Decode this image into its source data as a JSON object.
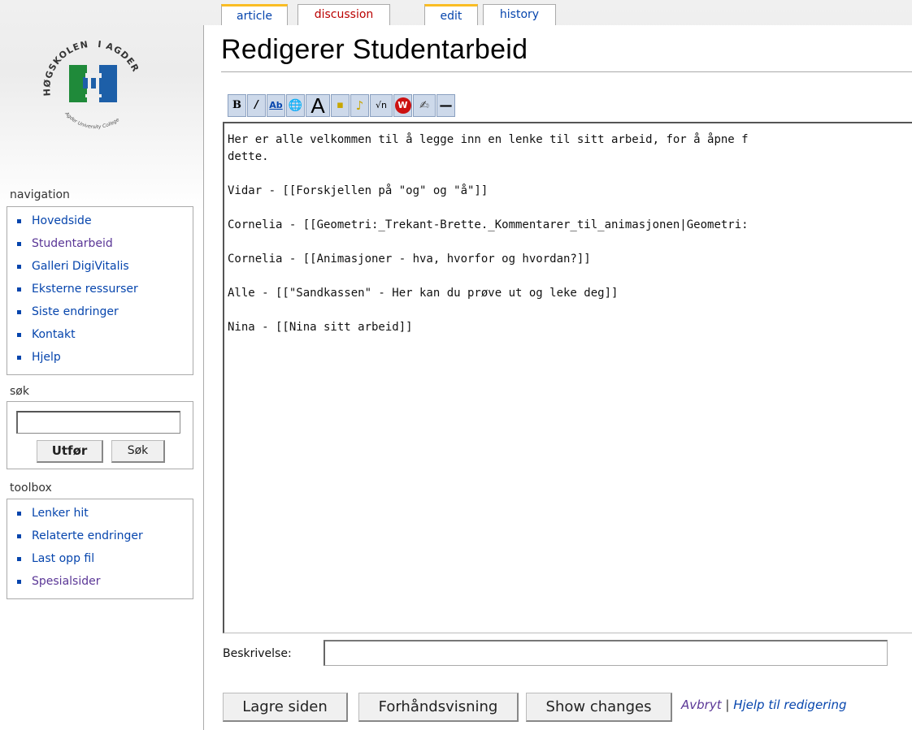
{
  "tabs": [
    {
      "label": "article"
    },
    {
      "label": "discussion"
    },
    {
      "label": "edit"
    },
    {
      "label": "history"
    }
  ],
  "logo": {
    "arc_text_left": "HØGSKOLEN",
    "arc_text_right": "I AGDER",
    "sub_text": "Agder University College",
    "colors": {
      "green": "#1f8a3a",
      "blue": "#1d5fa8"
    }
  },
  "sidebar": {
    "navigation": {
      "title": "navigation",
      "items": [
        {
          "label": "Hovedside"
        },
        {
          "label": "Studentarbeid"
        },
        {
          "label": "Galleri DigiVitalis"
        },
        {
          "label": "Eksterne ressurser"
        },
        {
          "label": "Siste endringer"
        },
        {
          "label": "Kontakt"
        },
        {
          "label": "Hjelp"
        }
      ]
    },
    "search": {
      "title": "søk",
      "value": "",
      "go_label": "Utfør",
      "search_label": "Søk"
    },
    "toolbox": {
      "title": "toolbox",
      "items": [
        {
          "label": "Lenker hit"
        },
        {
          "label": "Relaterte endringer"
        },
        {
          "label": "Last opp fil"
        },
        {
          "label": "Spesialsider"
        }
      ]
    }
  },
  "page": {
    "title": "Redigerer Studentarbeid"
  },
  "toolbar": {
    "buttons": [
      {
        "icon": "bold-icon",
        "glyph": "B"
      },
      {
        "icon": "italic-icon",
        "glyph": "/"
      },
      {
        "icon": "internal-link-icon",
        "glyph": "Ab"
      },
      {
        "icon": "external-link-icon",
        "glyph": "🌐"
      },
      {
        "icon": "headline-icon",
        "glyph": "A"
      },
      {
        "icon": "image-icon",
        "glyph": "▪"
      },
      {
        "icon": "media-icon",
        "glyph": "♪"
      },
      {
        "icon": "math-icon",
        "glyph": "√n"
      },
      {
        "icon": "nowiki-icon",
        "glyph": "W"
      },
      {
        "icon": "signature-icon",
        "glyph": "✍"
      },
      {
        "icon": "horizontal-line-icon",
        "glyph": "—"
      }
    ]
  },
  "editor": {
    "text": "Her er alle velkommen til å legge inn en lenke til sitt arbeid, for å åpne f\ndette.\n\nVidar - [[Forskjellen på \"og\" og \"å\"]]\n\nCornelia - [[Geometri:_Trekant-Brette._Kommentarer_til_animasjonen|Geometri:\n\nCornelia - [[Animasjoner - hva, hvorfor og hvordan?]]\n\nAlle - [[\"Sandkassen\" - Her kan du prøve ut og leke deg]]\n\nNina - [[Nina sitt arbeid]]"
  },
  "summary": {
    "label": "Beskrivelse:",
    "value": ""
  },
  "actions": {
    "save_label": "Lagre siden",
    "preview_label": "Forhåndsvisning",
    "diff_label": "Show changes",
    "cancel_label": "Avbryt",
    "separator": "|",
    "help_label": "Hjelp til redigering"
  }
}
